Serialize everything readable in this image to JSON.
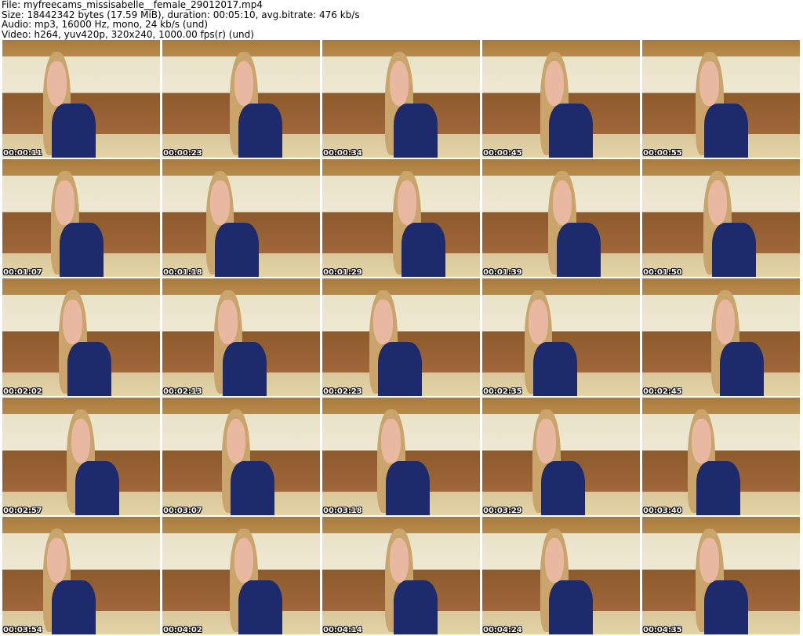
{
  "header": {
    "file": "File: myfreecams_missisabelle__female_29012017.mp4",
    "size": "Size: 18442342 bytes (17.59 MiB), duration: 00:05:10, avg.bitrate: 476 kb/s",
    "audio": "Audio: mp3, 16000 Hz, mono, 24 kb/s (und)",
    "video": "Video: h264, yuv420p, 320x240, 1000.00 fps(r) (und)"
  },
  "thumbnails": [
    "00:00:11",
    "00:00:23",
    "00:00:34",
    "00:00:45",
    "00:00:55",
    "00:01:07",
    "00:01:18",
    "00:01:29",
    "00:01:39",
    "00:01:50",
    "00:02:02",
    "00:02:13",
    "00:02:23",
    "00:02:35",
    "00:02:45",
    "00:02:57",
    "00:03:07",
    "00:03:18",
    "00:03:29",
    "00:03:40",
    "00:03:54",
    "00:04:02",
    "00:04:14",
    "00:04:24",
    "00:04:35"
  ]
}
